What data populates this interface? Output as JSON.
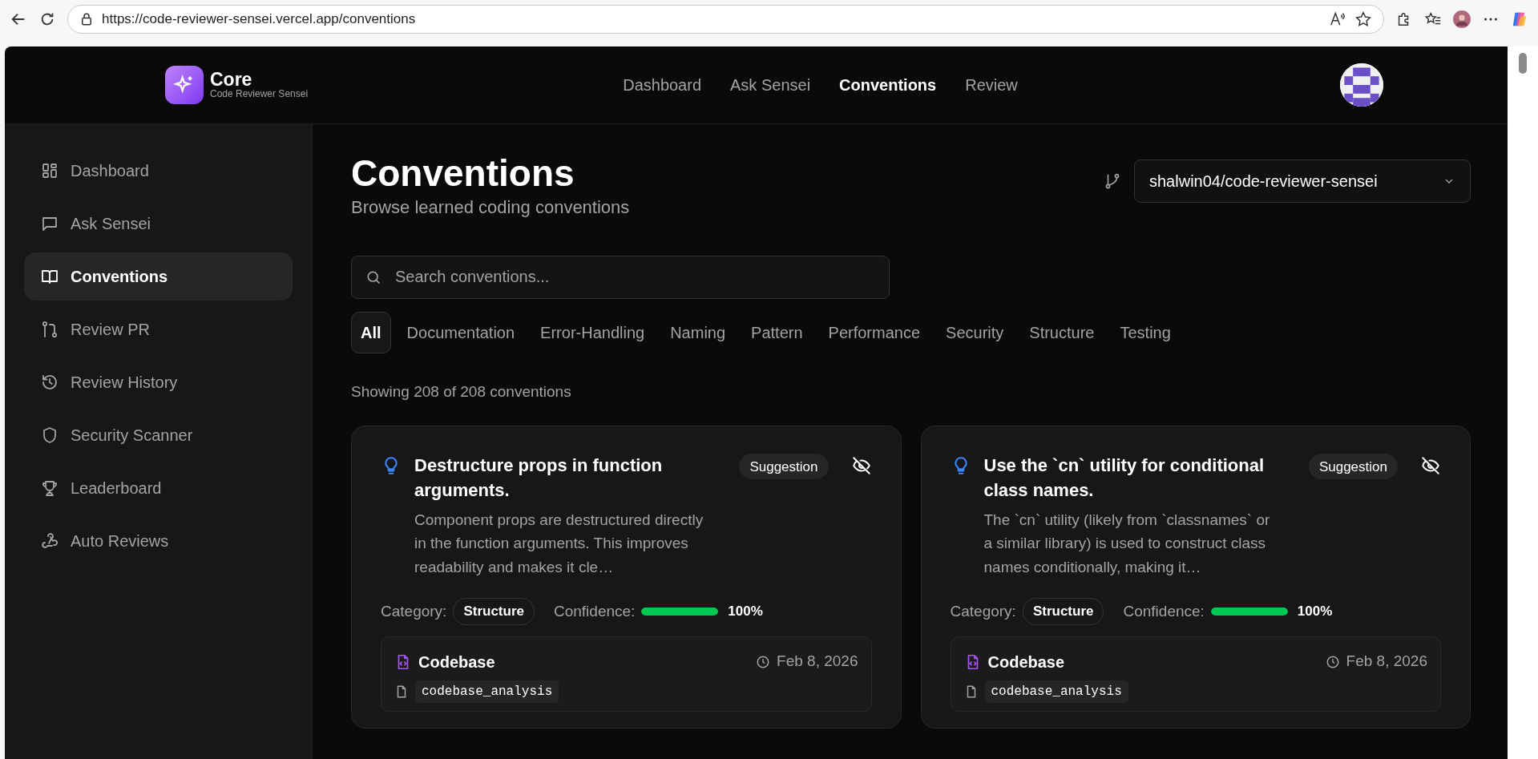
{
  "browser": {
    "url": "https://code-reviewer-sensei.vercel.app/conventions"
  },
  "app": {
    "brand": "Core",
    "tagline": "Code Reviewer Sensei",
    "nav": [
      {
        "label": "Dashboard",
        "selected": false
      },
      {
        "label": "Ask Sensei",
        "selected": false
      },
      {
        "label": "Conventions",
        "selected": true
      },
      {
        "label": "Review",
        "selected": false
      }
    ]
  },
  "sidebar": {
    "items": [
      {
        "label": "Dashboard",
        "selected": false
      },
      {
        "label": "Ask Sensei",
        "selected": false
      },
      {
        "label": "Conventions",
        "selected": true
      },
      {
        "label": "Review PR",
        "selected": false
      },
      {
        "label": "Review History",
        "selected": false
      },
      {
        "label": "Security Scanner",
        "selected": false
      },
      {
        "label": "Leaderboard",
        "selected": false
      },
      {
        "label": "Auto Reviews",
        "selected": false
      }
    ]
  },
  "page": {
    "title": "Conventions",
    "subtitle": "Browse learned coding conventions",
    "repo": "shalwin04/code-reviewer-sensei",
    "search": {
      "placeholder": "Search conventions..."
    },
    "filters": [
      {
        "label": "All",
        "selected": true
      },
      {
        "label": "Documentation",
        "selected": false
      },
      {
        "label": "Error-Handling",
        "selected": false
      },
      {
        "label": "Naming",
        "selected": false
      },
      {
        "label": "Pattern",
        "selected": false
      },
      {
        "label": "Performance",
        "selected": false
      },
      {
        "label": "Security",
        "selected": false
      },
      {
        "label": "Structure",
        "selected": false
      },
      {
        "label": "Testing",
        "selected": false
      }
    ],
    "count": "Showing 208 of 208 conventions"
  },
  "cards": [
    {
      "title": "Destructure props in function arguments.",
      "badge": "Suggestion",
      "description": "Component props are destructured directly in the function arguments. This improves readability and makes it cle…",
      "category_label": "Category:",
      "category": "Structure",
      "confidence_label": "Confidence:",
      "level": 1,
      "reading": "100%",
      "source": "Codebase",
      "date": "Feb 8, 2026",
      "file": "codebase_analysis"
    },
    {
      "title": "Use the `cn` utility for conditional class names.",
      "badge": "Suggestion",
      "description": "The `cn` utility (likely from `classnames` or a similar library) is used to construct class names conditionally, making it…",
      "category_label": "Category:",
      "category": "Structure",
      "confidence_label": "Confidence:",
      "level": 1,
      "reading": "100%",
      "source": "Codebase",
      "date": "Feb 8, 2026",
      "file": "codebase_analysis"
    }
  ]
}
